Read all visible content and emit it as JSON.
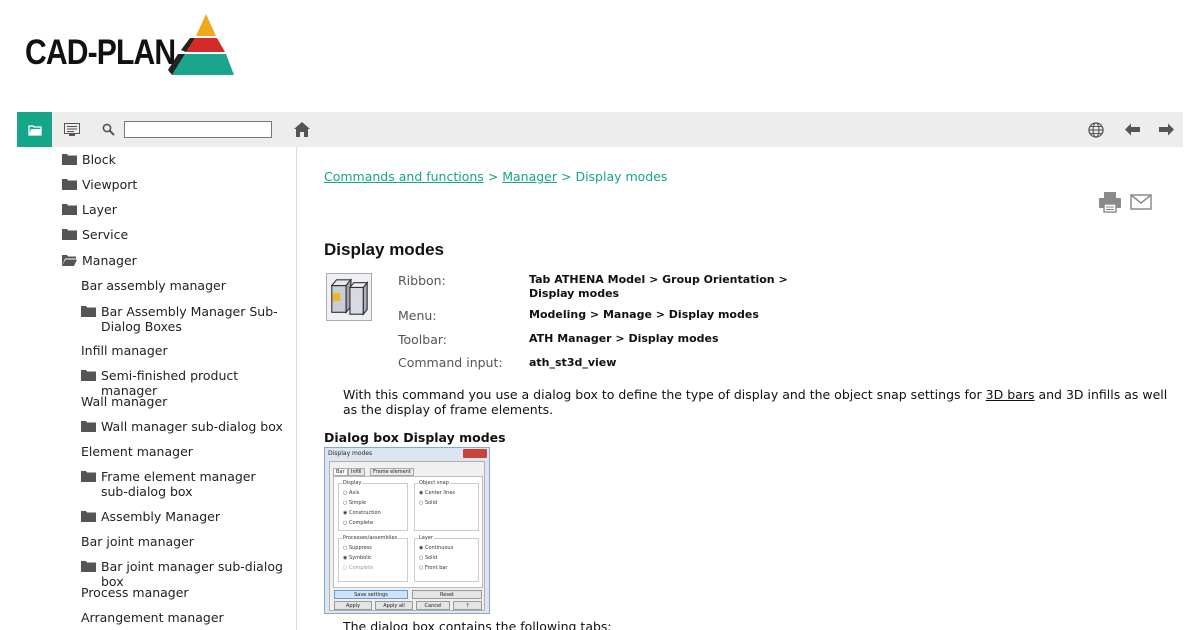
{
  "logo": {
    "text": "CAD-PLAN"
  },
  "toolbar": {
    "search_value": ""
  },
  "sidebar": {
    "items": [
      {
        "label": "Block",
        "icon": "folder-icon"
      },
      {
        "label": "Viewport",
        "icon": "folder-icon"
      },
      {
        "label": "Layer",
        "icon": "folder-icon"
      },
      {
        "label": "Service",
        "icon": "folder-icon"
      },
      {
        "label": "Manager",
        "icon": "folder-open-icon"
      },
      {
        "label": "Bar assembly manager",
        "icon": ""
      },
      {
        "label": "Bar Assembly Manager Sub-Dialog Boxes",
        "icon": "folder-icon"
      },
      {
        "label": "Infill manager",
        "icon": ""
      },
      {
        "label": "Semi-finished product manager",
        "icon": "folder-icon"
      },
      {
        "label": "Wall manager",
        "icon": ""
      },
      {
        "label": "Wall manager sub-dialog box",
        "icon": "folder-icon"
      },
      {
        "label": "Element manager",
        "icon": ""
      },
      {
        "label": "Frame element manager sub-dialog box",
        "icon": "folder-icon"
      },
      {
        "label": "Assembly Manager",
        "icon": "folder-icon"
      },
      {
        "label": "Bar joint manager",
        "icon": ""
      },
      {
        "label": "Bar joint manager sub-dialog box",
        "icon": "folder-icon"
      },
      {
        "label": "Process manager",
        "icon": ""
      },
      {
        "label": "Arrangement manager",
        "icon": ""
      }
    ]
  },
  "breadcrumb": {
    "link1": "Commands and functions",
    "sep1": " > ",
    "link2": "Manager",
    "sep2": " > ",
    "current": "Display modes"
  },
  "page": {
    "title": "Display modes",
    "ribbon_label": "Ribbon:",
    "ribbon_value": "Tab ATHENA Model > Group Orientation > Display modes",
    "menu_label": "Menu:",
    "menu_value": "Modeling > Manage > Display modes",
    "toolbar_label": "Toolbar:",
    "toolbar_value": "ATH Manager > Display modes",
    "cmd_label": "Command input:",
    "cmd_value": "ath_st3d_view",
    "para_before": "With this command you use a dialog box to define the type of display and the object snap settings for ",
    "para_link": "3D bars",
    "para_after": " and 3D infills as well as the display of frame elements.",
    "section_heading": "Dialog box Display modes",
    "footer_text": "The dialog box contains the following tabs:"
  },
  "dialog": {
    "title": "Display modes",
    "tabs": [
      "Bar",
      "Infill",
      "Frame element"
    ],
    "display_group": "Display",
    "display_opts": [
      "Axis",
      "Simple",
      "Construction",
      "Complete"
    ],
    "snap_group": "Object snap",
    "snap_opts": [
      "Center lines",
      "Solid"
    ],
    "proc_group": "Processes/assemblies",
    "proc_opts": [
      "Suppress",
      "Symbolic",
      "Complete"
    ],
    "layer_group": "Layer",
    "layer_opts": [
      "Continuous",
      "Solid",
      "Front bar"
    ],
    "btn_save": "Save settings",
    "btn_reset": "Reset",
    "btn_apply": "Apply",
    "btn_apply_all": "Apply all",
    "btn_cancel": "Cancel",
    "btn_help": "?"
  },
  "colors": {
    "accent": "#15a589",
    "toolbar_bg": "#ededed"
  }
}
